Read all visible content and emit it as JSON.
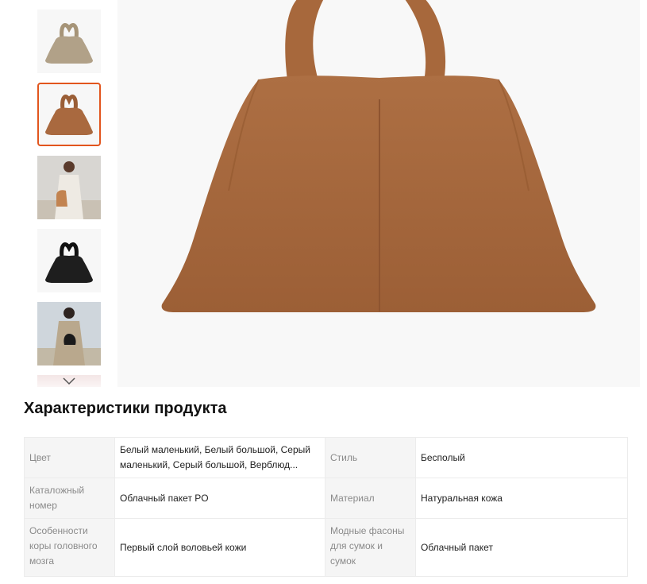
{
  "gallery": {
    "thumbnails": [
      {
        "name": "thumb-taupe-bag",
        "color": "#b1a188"
      },
      {
        "name": "thumb-camel-bag",
        "color": "#a9693f",
        "active": true
      },
      {
        "name": "thumb-model-white-coat",
        "color": "#c28350"
      },
      {
        "name": "thumb-black-bag",
        "color": "#1e1e1e"
      },
      {
        "name": "thumb-model-trench",
        "color": "#b9a88d"
      }
    ],
    "scroll_icon": "chevron-down-icon",
    "main_image_color": "#a8683c"
  },
  "specs": {
    "title": "Характеристики продукта",
    "rows": [
      {
        "left_label": "Цвет",
        "left_value": "Белый маленький, Белый большой, Серый маленький, Серый большой, Верблюд...",
        "right_label": "Стиль",
        "right_value": "Бесполый"
      },
      {
        "left_label": "Каталожный номер",
        "left_value": "Облачный пакет PO",
        "right_label": "Материал",
        "right_value": "Натуральная кожа"
      },
      {
        "left_label": "Особенности коры головного мозга",
        "left_value": "Первый слой воловьей кожи",
        "right_label": "Модные фасоны для сумок и сумок",
        "right_value": "Облачный пакет"
      }
    ]
  }
}
